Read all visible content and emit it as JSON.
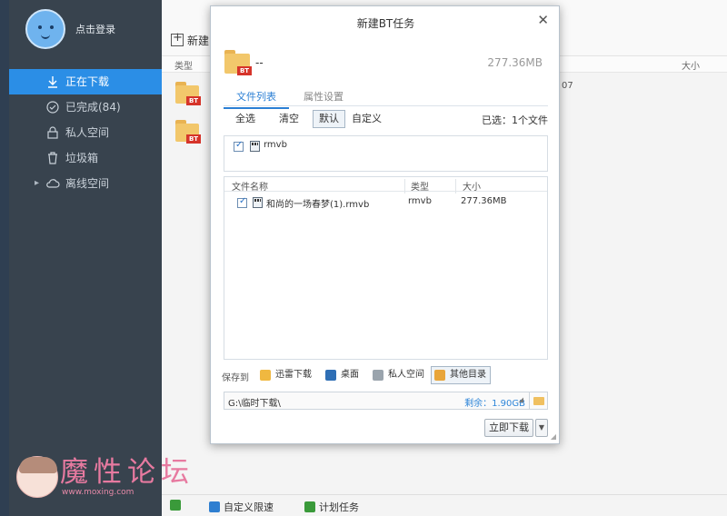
{
  "sidebar": {
    "login_label": "点击登录",
    "items": [
      {
        "label": "正在下载",
        "icon": "download-icon",
        "active": true
      },
      {
        "label": "已完成(84)",
        "icon": "check-circle-icon",
        "active": false
      },
      {
        "label": "私人空间",
        "icon": "lock-icon",
        "active": false
      },
      {
        "label": "垃圾箱",
        "icon": "trash-icon",
        "active": false
      },
      {
        "label": "离线空间",
        "icon": "cloud-icon",
        "active": false
      }
    ]
  },
  "main": {
    "new_label": "新建",
    "col_type": "类型",
    "col_size": "大小",
    "partial_text": "07",
    "bottom": {
      "speed_label": "自定义限速",
      "schedule_label": "计划任务"
    }
  },
  "watermark": {
    "text": "魔性论坛",
    "url": "www.moxing.com"
  },
  "dialog": {
    "title": "新建BT任务",
    "torrent_name": "--",
    "torrent_size": "277.36MB",
    "tabs": [
      {
        "label": "文件列表",
        "active": true
      },
      {
        "label": "属性设置",
        "active": false
      }
    ],
    "filters": [
      {
        "label": "全选"
      },
      {
        "label": "清空"
      },
      {
        "label": "默认",
        "selected": true
      },
      {
        "label": "自定义"
      }
    ],
    "selected_info": "已选：1个文件",
    "type_filter": {
      "label": "rmvb",
      "checked": true
    },
    "table": {
      "headers": [
        "文件名称",
        "类型",
        "大小"
      ],
      "rows": [
        {
          "name": "和尚的一场春梦(1).rmvb",
          "type": "rmvb",
          "size": "277.36MB",
          "checked": true
        }
      ]
    },
    "save_to_label": "保存到",
    "save_options": [
      {
        "label": "迅雷下载",
        "icon": "folder-icon"
      },
      {
        "label": "桌面",
        "icon": "desktop-icon"
      },
      {
        "label": "私人空间",
        "icon": "cloud-drive-icon"
      },
      {
        "label": "其他目录",
        "icon": "folder-open-icon",
        "selected": true
      }
    ],
    "path": "G:\\临时下载\\",
    "remaining": "剩余：1.90GB",
    "download_label": "立即下载",
    "colors": {
      "accent": "#2b7fd4",
      "sidebar_bg": "#38434e",
      "active_nav": "#2b8ee6"
    }
  }
}
